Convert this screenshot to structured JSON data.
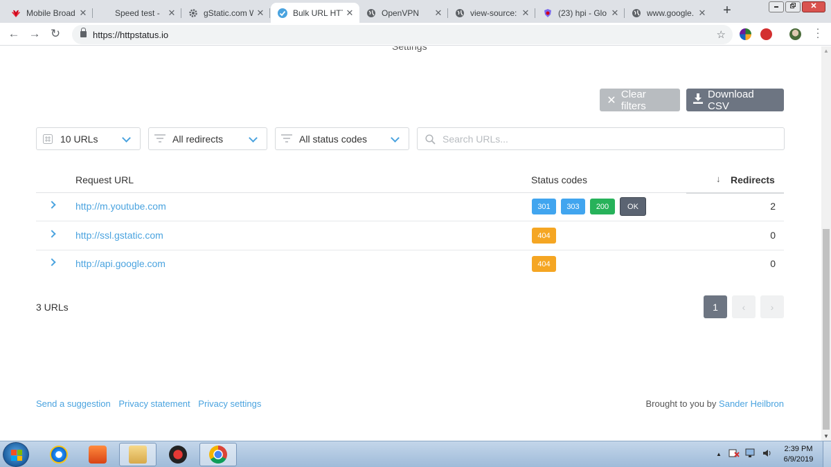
{
  "browser": {
    "tabs": [
      {
        "title": "Mobile Broad",
        "favicon_color": "#d0021b",
        "active": false
      },
      {
        "title": "Speed test - ",
        "favicon_color": "#ffffff",
        "active": false
      },
      {
        "title": "gStatic.com W",
        "favicon_color": "#5f6368",
        "active": false
      },
      {
        "title": "Bulk URL HTT",
        "favicon_color": "#4aa3df",
        "active": true
      },
      {
        "title": "OpenVPN",
        "favicon_color": "#5f6368",
        "active": false
      },
      {
        "title": "view-source:",
        "favicon_color": "#5f6368",
        "active": false
      },
      {
        "title": "(23) hpi - Glo",
        "favicon_color": "#7b68ee",
        "active": false
      },
      {
        "title": "www.google.",
        "favicon_color": "#5f6368",
        "active": false
      }
    ],
    "close_glyph": "✕",
    "new_tab_glyph": "+",
    "address": "https://httpstatus.io",
    "nav": {
      "back": "←",
      "forward": "→",
      "reload": "↻"
    },
    "star_icon": "star-icon",
    "menu_glyph": "⋮"
  },
  "page": {
    "settings_label": "Settings",
    "actions": {
      "clear_filters": "Clear filters",
      "download_csv": "Download CSV"
    },
    "filters": {
      "urls": "10 URLs",
      "redirects": "All redirects",
      "status_codes": "All status codes",
      "search_placeholder": "Search URLs..."
    },
    "table": {
      "headers": {
        "url": "Request URL",
        "status": "Status codes",
        "redirects": "Redirects",
        "sort_glyph": "↓"
      },
      "rows": [
        {
          "url": "http://m.youtube.com",
          "codes": [
            "301",
            "303",
            "200",
            "OK"
          ],
          "redirects": "2"
        },
        {
          "url": "http://ssl.gstatic.com",
          "codes": [
            "404"
          ],
          "redirects": "0"
        },
        {
          "url": "http://api.google.com",
          "codes": [
            "404"
          ],
          "redirects": "0"
        }
      ]
    },
    "result_count": "3 URLs",
    "pagination": {
      "current": "1",
      "prev": "‹",
      "next": "›"
    },
    "footer": {
      "links": [
        "Send a suggestion",
        "Privacy statement",
        "Privacy settings"
      ],
      "credit_prefix": "Brought to you by",
      "credit_name": "Sander Heilbron"
    }
  },
  "taskbar": {
    "time": "2:39 PM",
    "date": "6/9/2019",
    "tray_up": "▲"
  },
  "colors": {
    "accent": "#4aa3df",
    "badge_blue": "#41a5ef",
    "badge_green": "#27b25a",
    "badge_orange": "#f5a623",
    "badge_ok": "#5b6472"
  }
}
